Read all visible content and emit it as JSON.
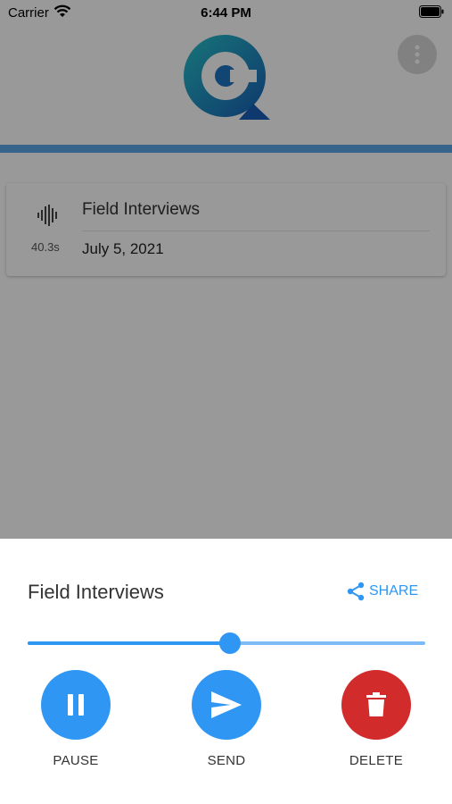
{
  "status_bar": {
    "carrier": "Carrier",
    "time": "6:44 PM"
  },
  "header": {
    "logo_icon": "qc-logo-icon",
    "menu_icon": "more-vert-icon",
    "rule_color": "#5aa7e8"
  },
  "recordings": [
    {
      "title": "Field Interviews",
      "date": "July 5, 2021",
      "duration": "40.3s",
      "icon": "waveform-icon"
    }
  ],
  "player": {
    "title": "Field Interviews",
    "share_label": "SHARE",
    "progress": 0.51,
    "actions": [
      {
        "id": "pause",
        "label": "PAUSE",
        "icon": "pause-icon",
        "color": "#2f96f3"
      },
      {
        "id": "send",
        "label": "SEND",
        "icon": "send-icon",
        "color": "#2f96f3"
      },
      {
        "id": "delete",
        "label": "DELETE",
        "icon": "trash-icon",
        "color": "#d12b2b"
      }
    ]
  }
}
